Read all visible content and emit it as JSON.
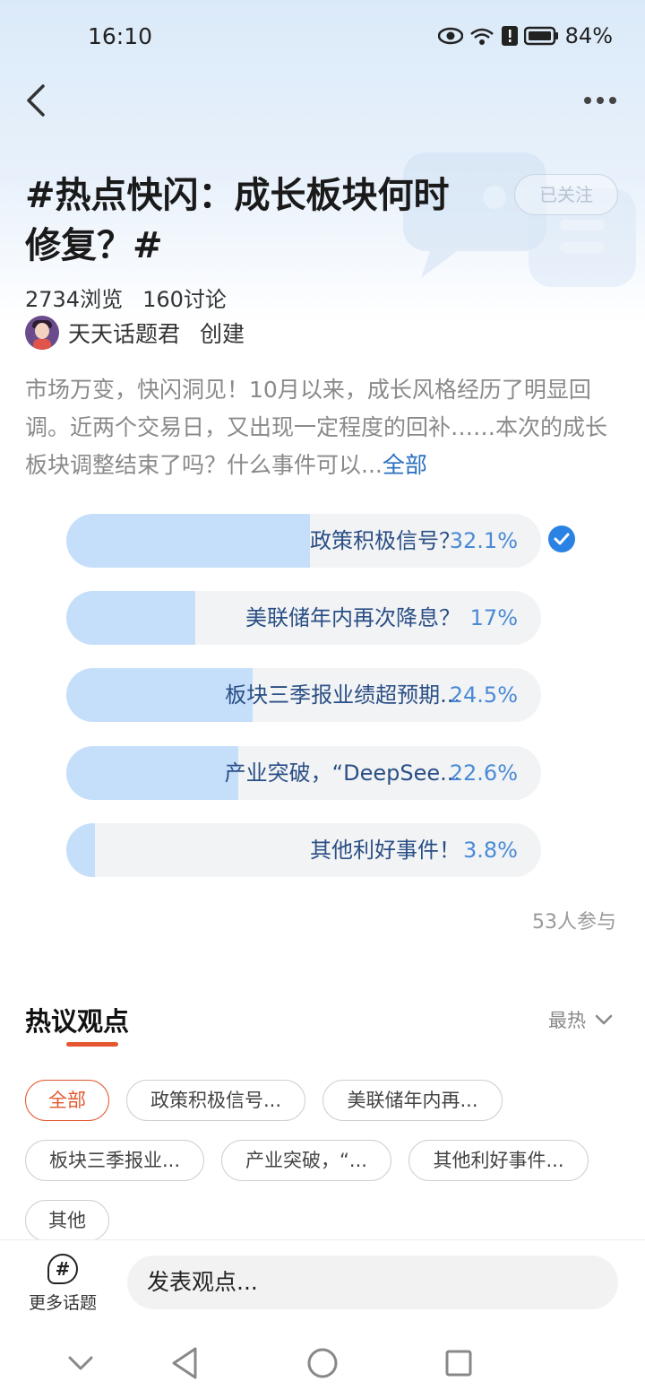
{
  "status_bar": {
    "time": "16:10",
    "battery": "84%",
    "icons": [
      "eye-icon",
      "wifi-icon",
      "alert-icon",
      "battery-icon"
    ]
  },
  "header": {
    "back_icon": "back-icon",
    "more_icon": "more-icon"
  },
  "topic": {
    "title": "#热点快闪：成长板块何时修复？#",
    "follow_label": "已关注",
    "views": "2734浏览",
    "discussions": "160讨论",
    "creator_name": "天天话题君",
    "creator_role": "创建",
    "description": "市场万变，快闪洞见！10月以来，成长风格经历了明显回调。近两个交易日，又出现一定程度的回补……本次的成长板块调整结束了吗？什么事件可以...",
    "description_more": "全部"
  },
  "poll": {
    "options": [
      {
        "label": "政策积极信号？",
        "percent": "32.1%",
        "value": 32.1,
        "selected": true
      },
      {
        "label": "美联储年内再次降息？",
        "percent": "17%",
        "value": 17,
        "selected": false
      },
      {
        "label": "板块三季报业绩超预期...",
        "percent": "24.5%",
        "value": 24.5,
        "selected": false
      },
      {
        "label": "产业突破，“DeepSee...",
        "percent": "22.6%",
        "value": 22.6,
        "selected": false
      },
      {
        "label": "其他利好事件！",
        "percent": "3.8%",
        "value": 3.8,
        "selected": false
      }
    ],
    "participants": "53人参与"
  },
  "opinions": {
    "title": "热议观点",
    "sort_label": "最热",
    "filters": [
      "全部",
      "政策积极信号...",
      "美联储年内再...",
      "板块三季报业...",
      "产业突破，“...",
      "其他利好事件...",
      "其他"
    ],
    "active_filter": "全部"
  },
  "bottom": {
    "more_topics_label": "更多话题",
    "input_placeholder": "发表观点..."
  },
  "colors": {
    "accent": "#e4572e",
    "link": "#2a6fbf",
    "poll_fill": "#c5dffa",
    "poll_text": "#2a4f85",
    "poll_percent": "#4a8ad6"
  }
}
